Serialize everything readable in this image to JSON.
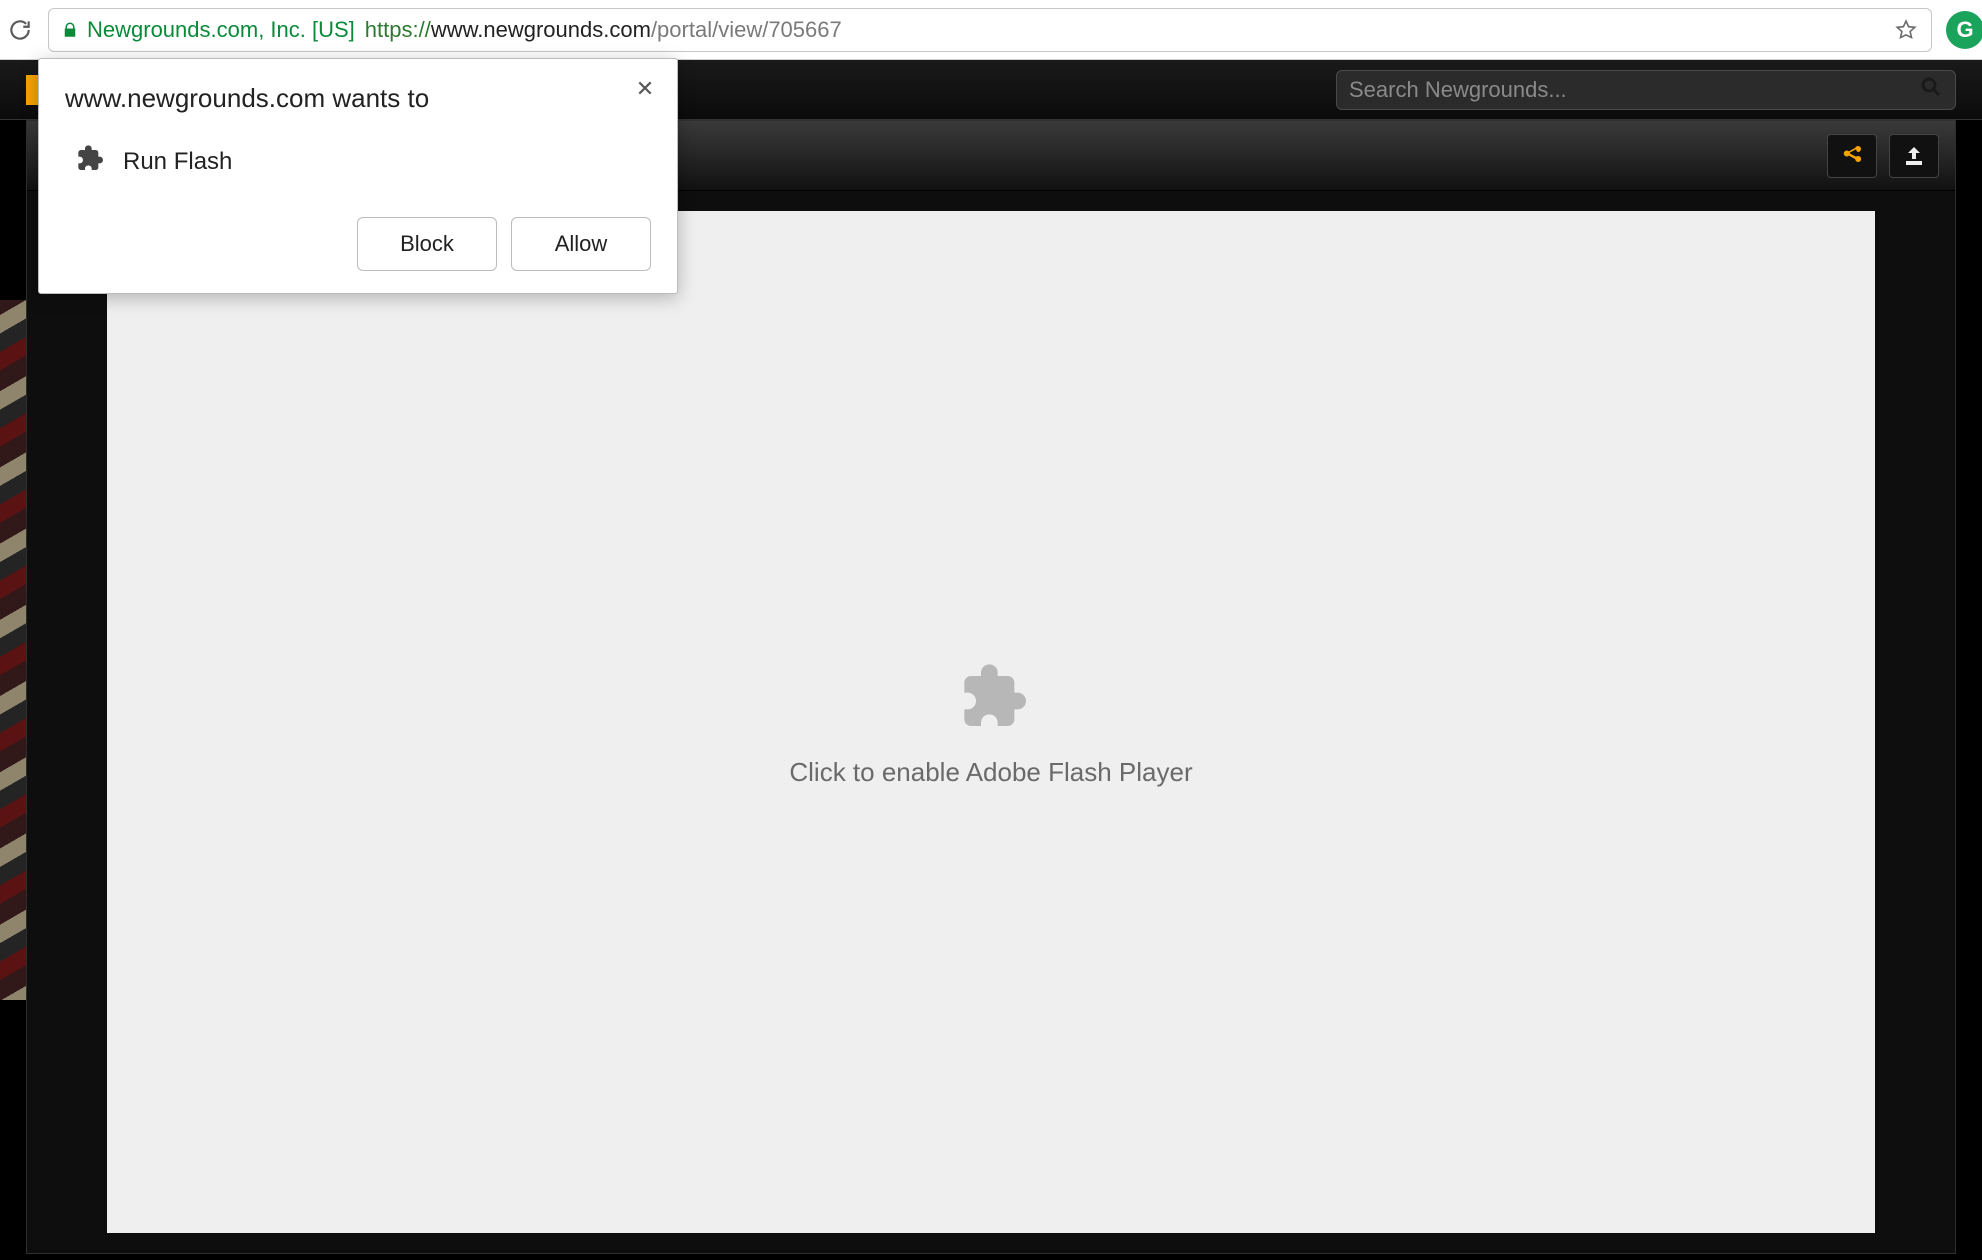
{
  "browser": {
    "security_label": "Newgrounds.com, Inc. [US]",
    "url_scheme": "https://",
    "url_host": "www.newgrounds.com",
    "url_path": "/portal/view/705667",
    "extension_letter": "G"
  },
  "site": {
    "search_placeholder": "Search Newgrounds..."
  },
  "flash": {
    "prompt": "Click to enable Adobe Flash Player"
  },
  "permission": {
    "origin_line": "www.newgrounds.com wants to",
    "request_label": "Run Flash",
    "block_label": "Block",
    "allow_label": "Allow"
  }
}
